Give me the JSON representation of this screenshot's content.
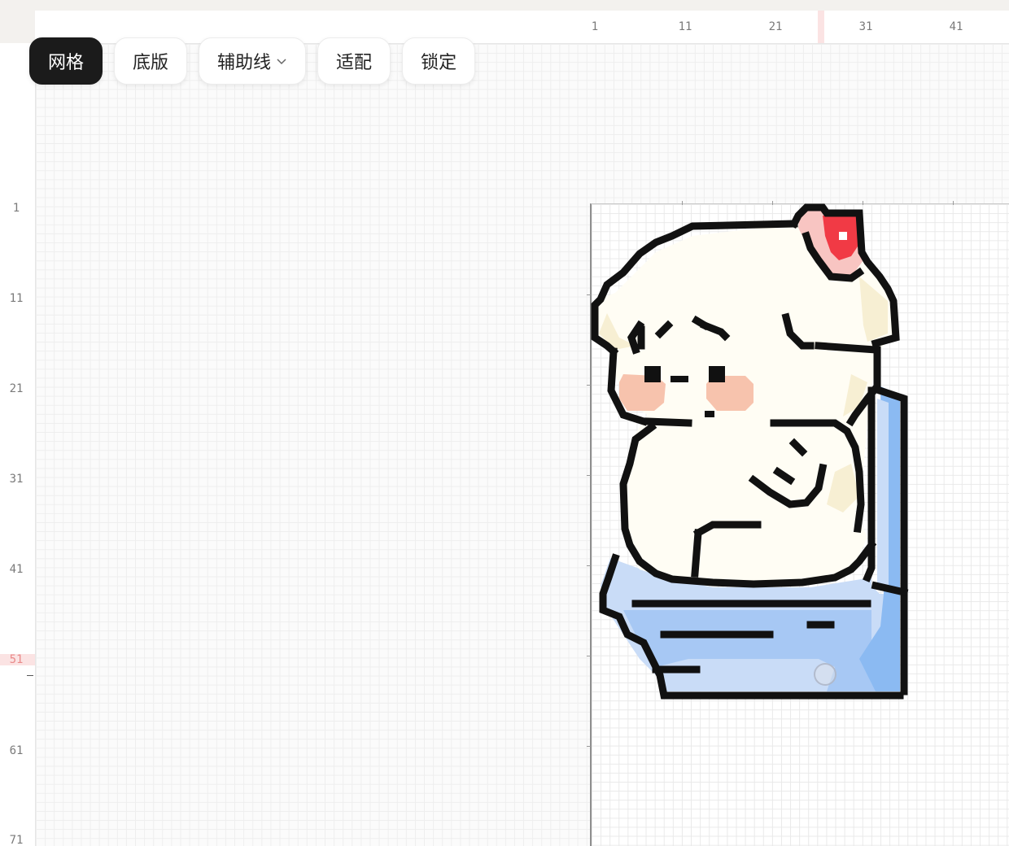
{
  "toolbar": {
    "grid_label": "网格",
    "base_label": "底版",
    "guides_label": "辅助线",
    "fit_label": "适配",
    "lock_label": "锁定",
    "active": "grid"
  },
  "ruler_top": {
    "labels": [
      "1",
      "11",
      "21",
      "31",
      "41"
    ],
    "highlighted_column": 29
  },
  "ruler_left": {
    "labels": [
      "1",
      "11",
      "21",
      "31",
      "41",
      "51",
      "61",
      "71"
    ],
    "highlighted_row": "51"
  },
  "colors": {
    "outline": "#111111",
    "body": "#fffdf4",
    "body_shade": "#f7efd3",
    "blush": "#f7c3ad",
    "heart": "#f13a45",
    "heart_light": "#f8c5c2",
    "cup_light": "#c9dcf7",
    "cup_mid": "#a7c8f4",
    "cup_dark": "#8bbaf2",
    "active_button": "#1b1b1b"
  }
}
